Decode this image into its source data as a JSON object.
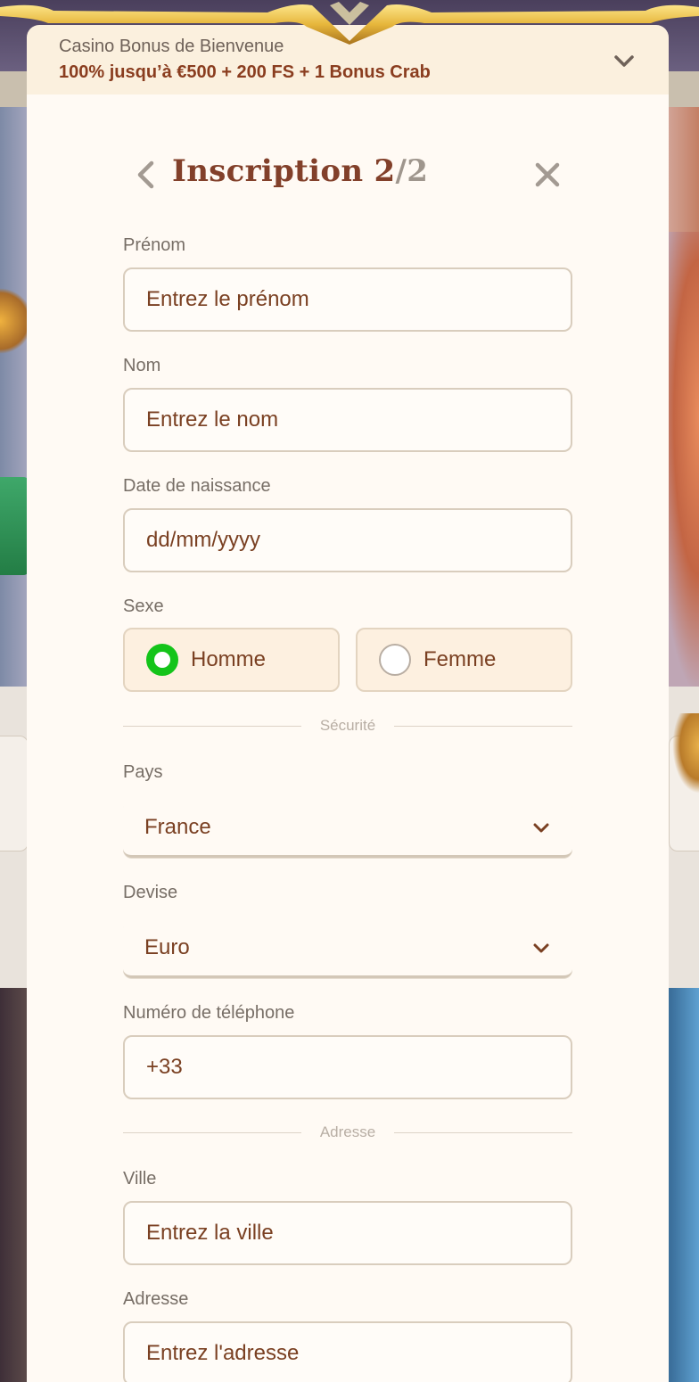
{
  "bonus": {
    "title": "Casino Bonus de Bienvenue",
    "offer": "100% jusqu’à €500 + 200 FS + 1 Bonus Crab"
  },
  "modal": {
    "title_main": "Inscription 2",
    "title_total": "/2"
  },
  "form": {
    "first_name": {
      "label": "Prénom",
      "placeholder": "Entrez le prénom"
    },
    "last_name": {
      "label": "Nom",
      "placeholder": "Entrez le nom"
    },
    "birth_date": {
      "label": "Date de naissance",
      "placeholder": "dd/mm/yyyy"
    },
    "gender": {
      "label": "Sexe",
      "options": [
        {
          "label": "Homme",
          "selected": true
        },
        {
          "label": "Femme",
          "selected": false
        }
      ]
    },
    "security_divider": "Sécurité",
    "country": {
      "label": "Pays",
      "value": "France"
    },
    "currency": {
      "label": "Devise",
      "value": "Euro"
    },
    "phone": {
      "label": "Numéro de téléphone",
      "value": "+33"
    },
    "address_divider": "Adresse",
    "city": {
      "label": "Ville",
      "placeholder": "Entrez la ville"
    },
    "address": {
      "label": "Adresse",
      "placeholder": "Entrez l'adresse"
    }
  },
  "colors": {
    "accent_brown": "#82402a",
    "radio_selected": "#14c41a",
    "panel_bg": "#fffaf4",
    "banner_bg": "#fbf0de"
  }
}
